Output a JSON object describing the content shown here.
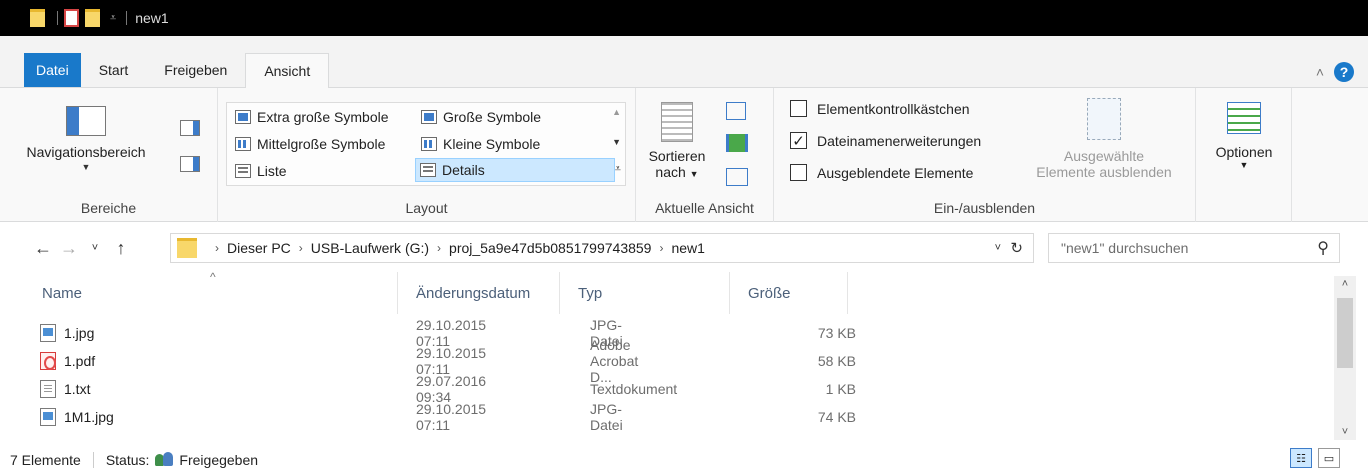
{
  "window": {
    "title": "new1"
  },
  "ribbon_tabs": [
    {
      "label": "Datei"
    },
    {
      "label": "Start"
    },
    {
      "label": "Freigeben"
    },
    {
      "label": "Ansicht"
    }
  ],
  "ribbon": {
    "bereiche": {
      "nav_pane_label": "Navigationsbereich",
      "group_label": "Bereiche"
    },
    "layout": {
      "items": [
        {
          "label": "Extra große Symbole"
        },
        {
          "label": "Große Symbole"
        },
        {
          "label": "Mittelgroße Symbole"
        },
        {
          "label": "Kleine Symbole"
        },
        {
          "label": "Liste"
        },
        {
          "label": "Details"
        }
      ],
      "selected": "Details",
      "group_label": "Layout"
    },
    "current_view": {
      "sort_label_1": "Sortieren",
      "sort_label_2": "nach",
      "group_label": "Aktuelle Ansicht"
    },
    "show_hide": {
      "checkboxes": [
        {
          "label": "Elementkontrollkästchen",
          "checked": false
        },
        {
          "label": "Dateinamenerweiterungen",
          "checked": true
        },
        {
          "label": "Ausgeblendete Elemente",
          "checked": false
        }
      ],
      "hide_selected_1": "Ausgewählte",
      "hide_selected_2": "Elemente ausblenden",
      "group_label": "Ein-/ausblenden"
    },
    "options_label": "Optionen"
  },
  "address": {
    "crumbs": [
      "Dieser PC",
      "USB-Laufwerk (G:)",
      "proj_5a9e47d5b0851799743859",
      "new1"
    ],
    "search_placeholder": "\"new1\" durchsuchen"
  },
  "columns": {
    "name": "Name",
    "date": "Änderungsdatum",
    "type": "Typ",
    "size": "Größe"
  },
  "files": [
    {
      "name": "1.jpg",
      "icon": "image-file-icon",
      "date": "29.10.2015 07:11",
      "type": "JPG-Datei",
      "size": "73 KB"
    },
    {
      "name": "1.pdf",
      "icon": "pdf-file-icon",
      "date": "29.10.2015 07:11",
      "type": "Adobe Acrobat D...",
      "size": "58 KB"
    },
    {
      "name": "1.txt",
      "icon": "text-file-icon",
      "date": "29.07.2016 09:34",
      "type": "Textdokument",
      "size": "1 KB"
    },
    {
      "name": "1M1.jpg",
      "icon": "image-file-icon",
      "date": "29.10.2015 07:11",
      "type": "JPG-Datei",
      "size": "74 KB"
    }
  ],
  "status": {
    "count": "7 Elemente",
    "status_label": "Status:",
    "status_value": "Freigegeben"
  },
  "colors": {
    "accent": "#1979ca",
    "selection": "#cce8ff",
    "title_bg": "#000000"
  }
}
